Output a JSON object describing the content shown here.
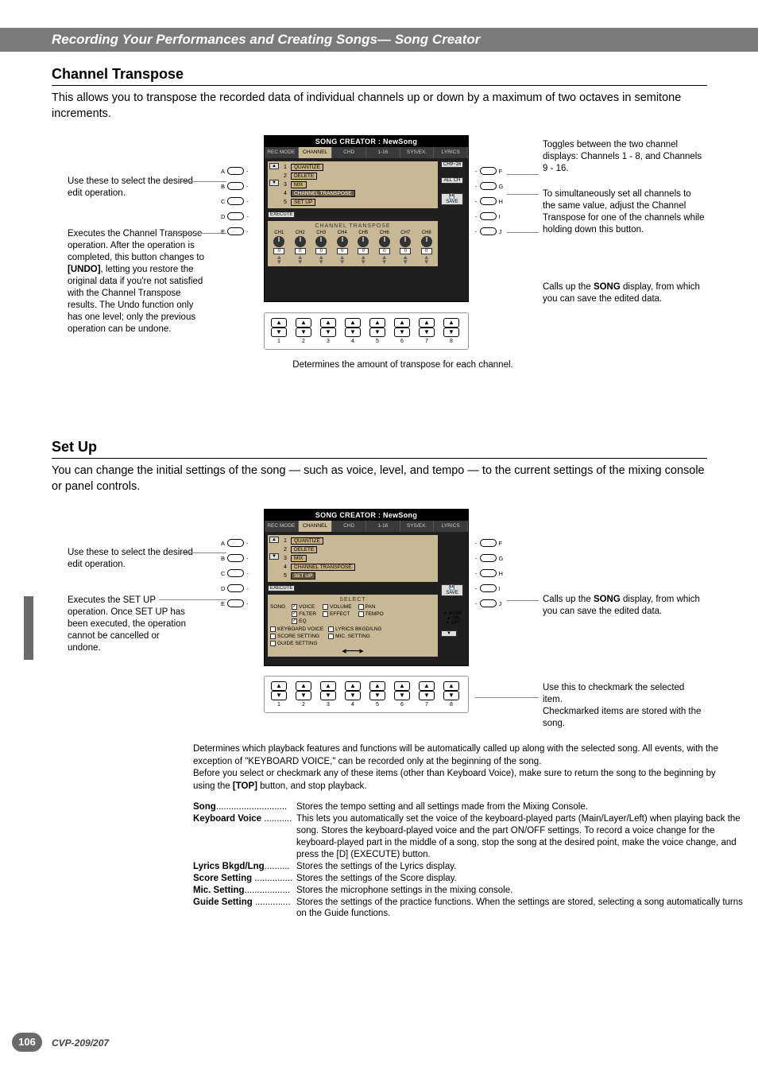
{
  "header": "Recording Your Performances and Creating Songs— Song Creator",
  "section1": {
    "title": "Channel Transpose",
    "desc": "This allows you to transpose the recorded data of individual channels up or down by a maximum of two octaves in semitone increments."
  },
  "section2": {
    "title": "Set Up",
    "desc": "You can change the initial settings of the song — such as voice, level, and tempo — to the current settings of the mixing console or panel controls."
  },
  "callouts": {
    "ct_left1": "Use these to select the desired edit operation.",
    "ct_left2_a": "Executes the Channel Transpose operation. After the operation is completed, this button changes to ",
    "ct_left2_undo": "[UNDO]",
    "ct_left2_b": ", letting you restore the original data if you're not satisfied with the Channel Transpose results. The Undo function only has one level; only the previous operation can be undone.",
    "ct_right1": "Toggles between the two channel displays: Channels 1 - 8, and Channels 9 - 16.",
    "ct_right2": "To simultaneously set all channels to the same value, adjust the Channel Transpose for one of the channels while holding down this button.",
    "ct_right3_a": "Calls up the ",
    "ct_right3_song": "SONG",
    "ct_right3_b": " display, from which you can save the edited data.",
    "ct_bottom": "Determines the amount of transpose for each channel.",
    "su_left1": "Use these to select the desired edit operation.",
    "su_left2": "Executes the SET UP operation. Once SET UP has been executed, the operation cannot be cancelled or undone.",
    "su_right1_a": "Calls up the ",
    "su_right1_song": "SONG",
    "su_right1_b": " display, from which you can save the edited data.",
    "su_right2": "Use this to checkmark the selected item.\nCheckmarked items are stored with the song."
  },
  "lcd": {
    "title": "SONG CREATOR : NewSong",
    "tabs": [
      "REC MODE",
      "CHANNEL",
      "CHD",
      "1-16",
      "SYS/EX.",
      "LYRICS"
    ],
    "menu": {
      "items": [
        {
          "n": "1",
          "label": "QUANTIZE"
        },
        {
          "n": "2",
          "label": "DELETE"
        },
        {
          "n": "3",
          "label": "MIX"
        },
        {
          "n": "4",
          "label": "CHANNEL TRANSPOSE"
        },
        {
          "n": "5",
          "label": "SET UP"
        }
      ]
    },
    "ct": {
      "section": "CHANNEL TRANSPOSE",
      "channels": [
        "CH1",
        "CH2",
        "CH3",
        "CH4",
        "CH5",
        "CH6",
        "CH7",
        "CH8"
      ],
      "value": "0",
      "execute": "EXECUTE",
      "right_btns": [
        "CH9~16",
        "ALL CH",
        "SAVE"
      ],
      "save_icon": "💾"
    },
    "su": {
      "execute": "EXECUTE",
      "select": "SELECT",
      "save": "SAVE",
      "song_label": "SONG",
      "cols": {
        "c1": [
          "VOICE",
          "FILTER",
          "EQ"
        ],
        "c2": [
          "VOLUME",
          "EFFECT"
        ],
        "c3": [
          "PAN",
          "TEMPO"
        ]
      },
      "col1_checked": [
        true,
        true,
        true
      ],
      "row2": [
        "KEYBOARD VOICE",
        "SCORE SETTING",
        "GUIDE SETTING"
      ],
      "row2b": [
        "LYRICS BKGD/LNG",
        "MIC. SETTING"
      ],
      "mark": {
        "tick": "✔ MARK",
        "on": "▲ ON",
        "off": "▼ OFF"
      }
    }
  },
  "side_labels": {
    "A": "A",
    "B": "B",
    "C": "C",
    "D": "D",
    "E": "E",
    "F": "F",
    "G": "G",
    "H": "H",
    "I": "I",
    "J": "J"
  },
  "updown_nums": [
    "1",
    "2",
    "3",
    "4",
    "5",
    "6",
    "7",
    "8"
  ],
  "settings_intro": {
    "p1": "Determines which playback features and functions will be automatically called up along with the selected song. All events, with the exception of \"KEYBOARD VOICE,\" can be recorded only at the beginning of the song.",
    "p2a": "Before you select or checkmark any of these items (other than Keyboard Voice), make sure to return the song to the beginning by using the ",
    "p2_top": "[TOP]",
    "p2b": " button, and stop playback."
  },
  "definitions": [
    {
      "term": "Song",
      "dots": "............................",
      "text": "Stores the tempo setting and all settings made from the Mixing Console."
    },
    {
      "term": "Keyboard Voice",
      "dots": " ...........",
      "text": "This lets you automatically set the voice of the keyboard-played parts (Main/Layer/Left) when playing back the song. Stores the keyboard-played voice and the part ON/OFF settings. To record a voice change for the keyboard-played part in the middle of a song, stop the song at the desired point, make the voice change, and press the [D] (EXECUTE) button."
    },
    {
      "term": "Lyrics Bkgd/Lng",
      "dots": "..........",
      "text": "Stores the settings of the Lyrics display."
    },
    {
      "term": "Score Setting",
      "dots": " ...............",
      "text": "Stores the settings of the Score display."
    },
    {
      "term": "Mic. Setting",
      "dots": "..................",
      "text": "Stores the microphone settings in the mixing console."
    },
    {
      "term": "Guide Setting",
      "dots": " ..............",
      "text": "Stores the settings of the practice functions. When the settings are stored, selecting a song automatically turns on the Guide functions."
    }
  ],
  "page": {
    "num": "106",
    "model": "CVP-209/207"
  }
}
